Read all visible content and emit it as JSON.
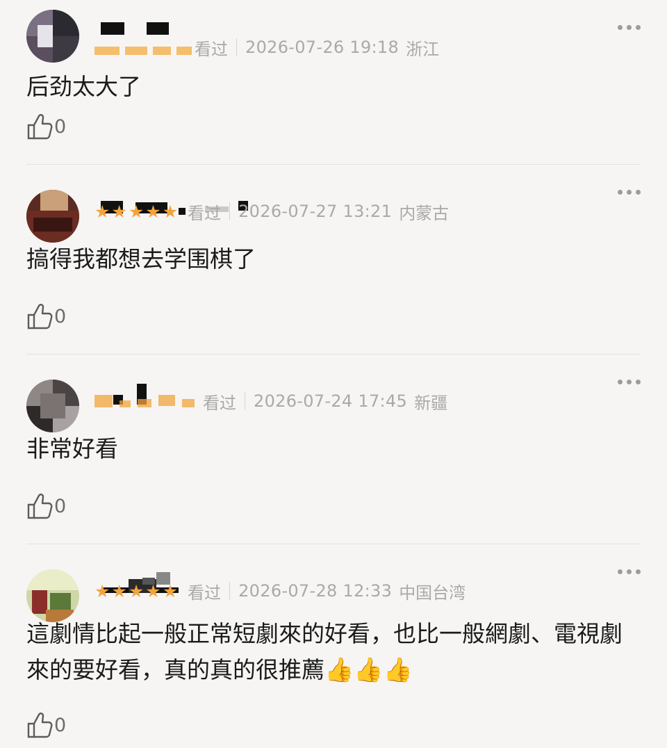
{
  "comments": [
    {
      "name_blurred": true,
      "rating_visible": false,
      "watched": "看过",
      "time": "2026-07-26 19:18",
      "region": "浙江",
      "content": "后劲太大了",
      "likes": "0"
    },
    {
      "name_blurred": true,
      "rating_visible": true,
      "rating": 5,
      "watched": "看过",
      "time": "2026-07-27 13:21",
      "region": "内蒙古",
      "content": "搞得我都想去学围棋了",
      "likes": "0"
    },
    {
      "name_blurred": true,
      "rating_visible": false,
      "watched": "看过",
      "time": "2026-07-24 17:45",
      "region": "新疆",
      "content": "非常好看",
      "likes": "0"
    },
    {
      "name_blurred": true,
      "rating_visible": true,
      "rating": 5,
      "watched": "看过",
      "time": "2026-07-28 12:33",
      "region": "中国台湾",
      "content": "這劇情比起一般正常短劇來的好看，也比一般網劇、電視劇來的要好看，真的真的很推薦",
      "content_emoji": "👍👍👍",
      "likes": "0"
    }
  ],
  "icons": {
    "more": "more-dots-icon",
    "like": "thumbs-up-icon",
    "star": "star-icon"
  },
  "colors": {
    "star": "#f2a43c",
    "meta": "#a9a9a9",
    "background": "#f6f5f3"
  }
}
